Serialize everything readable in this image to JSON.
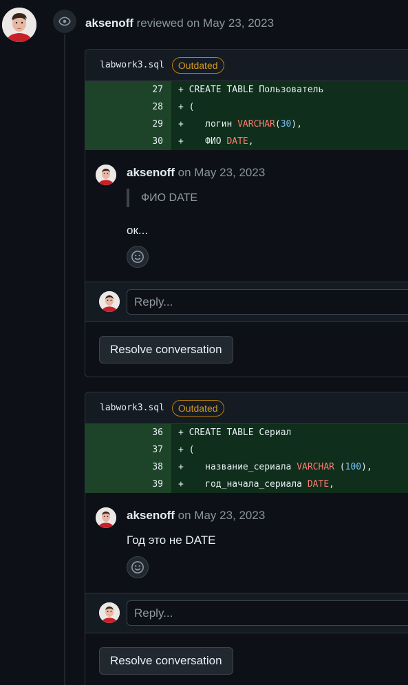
{
  "review": {
    "author": "aksenoff",
    "action_text": " reviewed on May 23, 2023"
  },
  "threads": [
    {
      "file": "labwork3.sql",
      "badge": "Outdated",
      "lines": [
        {
          "num": "27",
          "code": "+ CREATE TABLE Пользователь"
        },
        {
          "num": "28",
          "code": "+ ("
        },
        {
          "num": "29",
          "code_parts": [
            "+    логин ",
            "VARCHAR",
            "(",
            "30",
            "),"
          ]
        },
        {
          "num": "30",
          "code_parts": [
            "+    ФИО ",
            "DATE",
            ","
          ]
        }
      ],
      "comment": {
        "author": "aksenoff",
        "date": " on May 23, 2023",
        "quote": "ФИО DATE",
        "body": "ок..."
      },
      "reply_placeholder": "Reply...",
      "resolve_label": "Resolve conversation"
    },
    {
      "file": "labwork3.sql",
      "badge": "Outdated",
      "lines": [
        {
          "num": "36",
          "code": "+ CREATE TABLE Сериал"
        },
        {
          "num": "37",
          "code": "+ ("
        },
        {
          "num": "38",
          "code_parts": [
            "+    название_сериала ",
            "VARCHAR",
            " (",
            "100",
            "),"
          ]
        },
        {
          "num": "39",
          "code_parts": [
            "+    год_начала_сериала ",
            "DATE",
            ","
          ]
        }
      ],
      "comment": {
        "author": "aksenoff",
        "date": " on May 23, 2023",
        "body": "Год это не DATE"
      },
      "reply_placeholder": "Reply...",
      "resolve_label": "Resolve conversation"
    }
  ],
  "icons": {
    "review_badge": "eye-icon",
    "reaction": "smiley-icon"
  },
  "colors": {
    "background": "#0d1117",
    "added_line_number_bg": "#1d4428",
    "added_line_bg": "#0f2e1b",
    "outdated": "#d29922"
  }
}
